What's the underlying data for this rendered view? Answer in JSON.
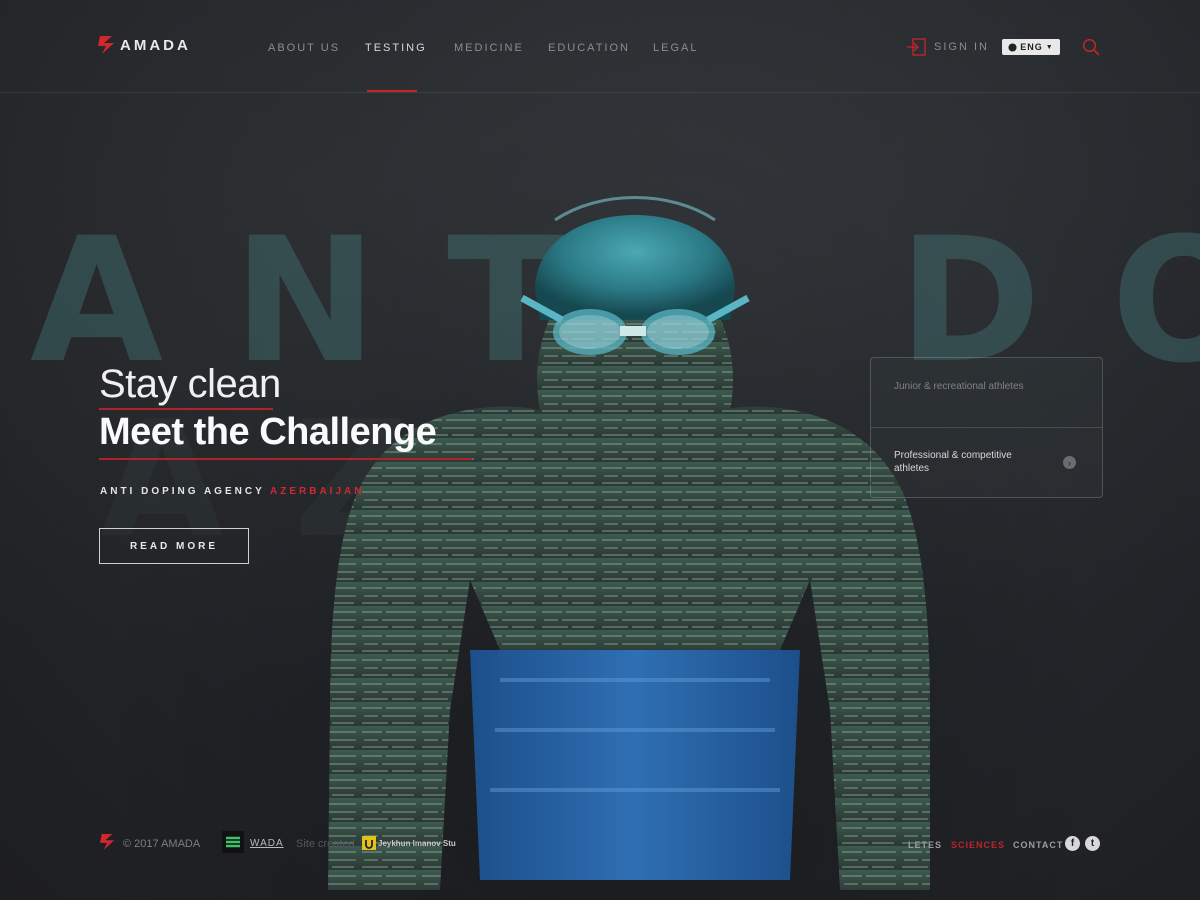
{
  "brand": {
    "name": "AMADA",
    "accent": "#c6262a"
  },
  "nav": {
    "items": [
      {
        "label": "ABOUT US"
      },
      {
        "label": "TESTING",
        "active": true
      },
      {
        "label": "MEDICINE"
      },
      {
        "label": "EDUCATION"
      },
      {
        "label": "LEGAL"
      }
    ],
    "sign_in": "SIGN IN",
    "language": "ENG",
    "icons": {
      "sign_in": "sign-in-icon",
      "language": "globe-icon",
      "search": "search-icon"
    }
  },
  "background": {
    "word_top": "ANTI DOPIN",
    "word_bottom": "AZ"
  },
  "hero": {
    "subtitle": "Stay clean",
    "title": "Meet the Challenge",
    "agency_prefix": "ANTI DOPING AGENCY",
    "agency_country": "AZERBAIJAN",
    "cta_label": "READ MORE"
  },
  "athlete_types": [
    {
      "label": "Junior & recreational athletes"
    },
    {
      "label": "Professional & competitive athletes",
      "arrow_icon": "chevron-right-icon"
    }
  ],
  "footer": {
    "copyright": "© 2017 AMADA",
    "wada": "WADA",
    "site_created": "Site created",
    "creator": "Jeykhun Imanov Stu",
    "links": [
      {
        "label": "LETES"
      },
      {
        "label": "SCIENCES",
        "highlight": true
      },
      {
        "label": "CONTACT"
      }
    ],
    "social": [
      "facebook-icon",
      "twitter-icon"
    ]
  }
}
